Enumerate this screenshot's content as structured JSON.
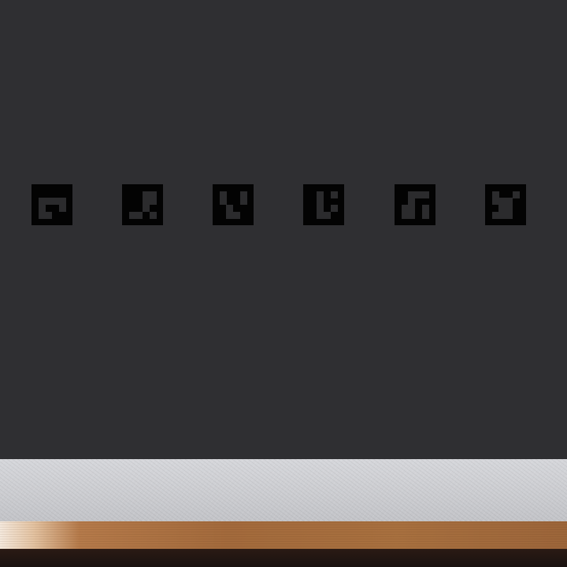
{
  "scene": {
    "colors": {
      "wall": "#2f2f32",
      "marker_border": "#030303",
      "marker_cell": "#2b2b2d",
      "ledge": "#cfd0d4",
      "wood": "#a36a3c",
      "base": "#1e1412"
    },
    "markers": [
      {
        "name": "marker-1",
        "bits": [
          [
            0,
            0,
            0,
            0
          ],
          [
            1,
            1,
            1,
            1
          ],
          [
            1,
            0,
            0,
            1
          ],
          [
            1,
            1,
            0,
            0
          ]
        ]
      },
      {
        "name": "marker-2",
        "bits": [
          [
            0,
            0,
            1,
            1
          ],
          [
            0,
            0,
            1,
            1
          ],
          [
            0,
            0,
            1,
            0
          ],
          [
            1,
            1,
            0,
            1
          ]
        ]
      },
      {
        "name": "marker-3",
        "bits": [
          [
            1,
            0,
            0,
            1
          ],
          [
            1,
            0,
            0,
            1
          ],
          [
            0,
            1,
            0,
            0
          ],
          [
            0,
            1,
            1,
            0
          ]
        ]
      },
      {
        "name": "marker-4",
        "bits": [
          [
            0,
            1,
            0,
            1
          ],
          [
            0,
            1,
            0,
            0
          ],
          [
            0,
            1,
            0,
            1
          ],
          [
            0,
            1,
            1,
            0
          ]
        ]
      },
      {
        "name": "marker-5",
        "bits": [
          [
            0,
            1,
            1,
            1
          ],
          [
            0,
            1,
            0,
            0
          ],
          [
            1,
            1,
            0,
            1
          ],
          [
            1,
            1,
            0,
            1
          ]
        ]
      },
      {
        "name": "marker-6",
        "bits": [
          [
            1,
            0,
            0,
            1
          ],
          [
            1,
            1,
            1,
            0
          ],
          [
            0,
            1,
            1,
            0
          ],
          [
            1,
            1,
            1,
            0
          ]
        ]
      }
    ]
  }
}
